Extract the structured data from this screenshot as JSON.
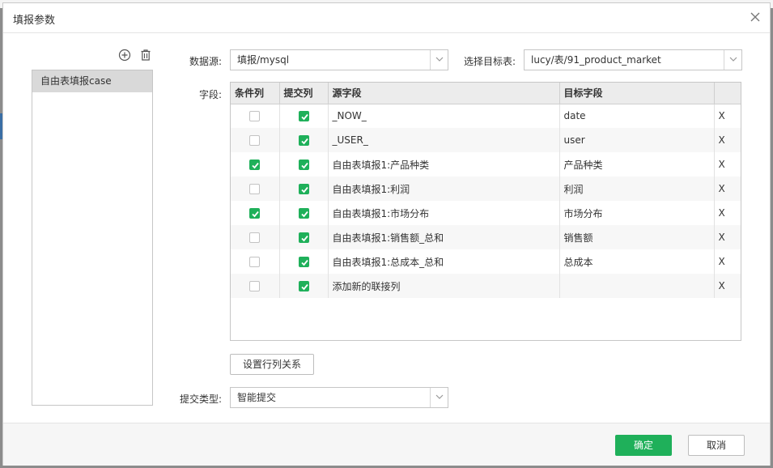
{
  "dialog": {
    "title": "填报参数"
  },
  "left_panel": {
    "items": [
      {
        "label": "自由表填报case",
        "selected": true
      }
    ]
  },
  "form": {
    "datasource_label": "数据源:",
    "datasource_value": "填报/mysql",
    "target_label": "选择目标表:",
    "target_value": "lucy/表/91_product_market",
    "fields_label": "字段:",
    "submit_type_label": "提交类型:",
    "submit_type_value": "智能提交",
    "relation_button": "设置行列关系"
  },
  "grid": {
    "headers": [
      "条件列",
      "提交列",
      "源字段",
      "目标字段",
      ""
    ],
    "rows": [
      {
        "condition": false,
        "submit": true,
        "source": "_NOW_",
        "target": "date",
        "del": "X"
      },
      {
        "condition": false,
        "submit": true,
        "source": "_USER_",
        "target": "user",
        "del": "X"
      },
      {
        "condition": true,
        "submit": true,
        "source": "自由表填报1:产品种类",
        "target": "产品种类",
        "del": "X"
      },
      {
        "condition": false,
        "submit": true,
        "source": "自由表填报1:利润",
        "target": "利润",
        "del": "X"
      },
      {
        "condition": true,
        "submit": true,
        "source": "自由表填报1:市场分布",
        "target": "市场分布",
        "del": "X"
      },
      {
        "condition": false,
        "submit": true,
        "source": "自由表填报1:销售额_总和",
        "target": "销售额",
        "del": "X"
      },
      {
        "condition": false,
        "submit": true,
        "source": "自由表填报1:总成本_总和",
        "target": "总成本",
        "del": "X"
      },
      {
        "condition": false,
        "submit": true,
        "source": "添加新的联接列",
        "target": "",
        "del": "X"
      }
    ]
  },
  "footer": {
    "ok": "确定",
    "cancel": "取消"
  },
  "colors": {
    "accent": "#1fb05a",
    "selected_item": "#d9d9d9",
    "header_bg": "#ececec"
  }
}
